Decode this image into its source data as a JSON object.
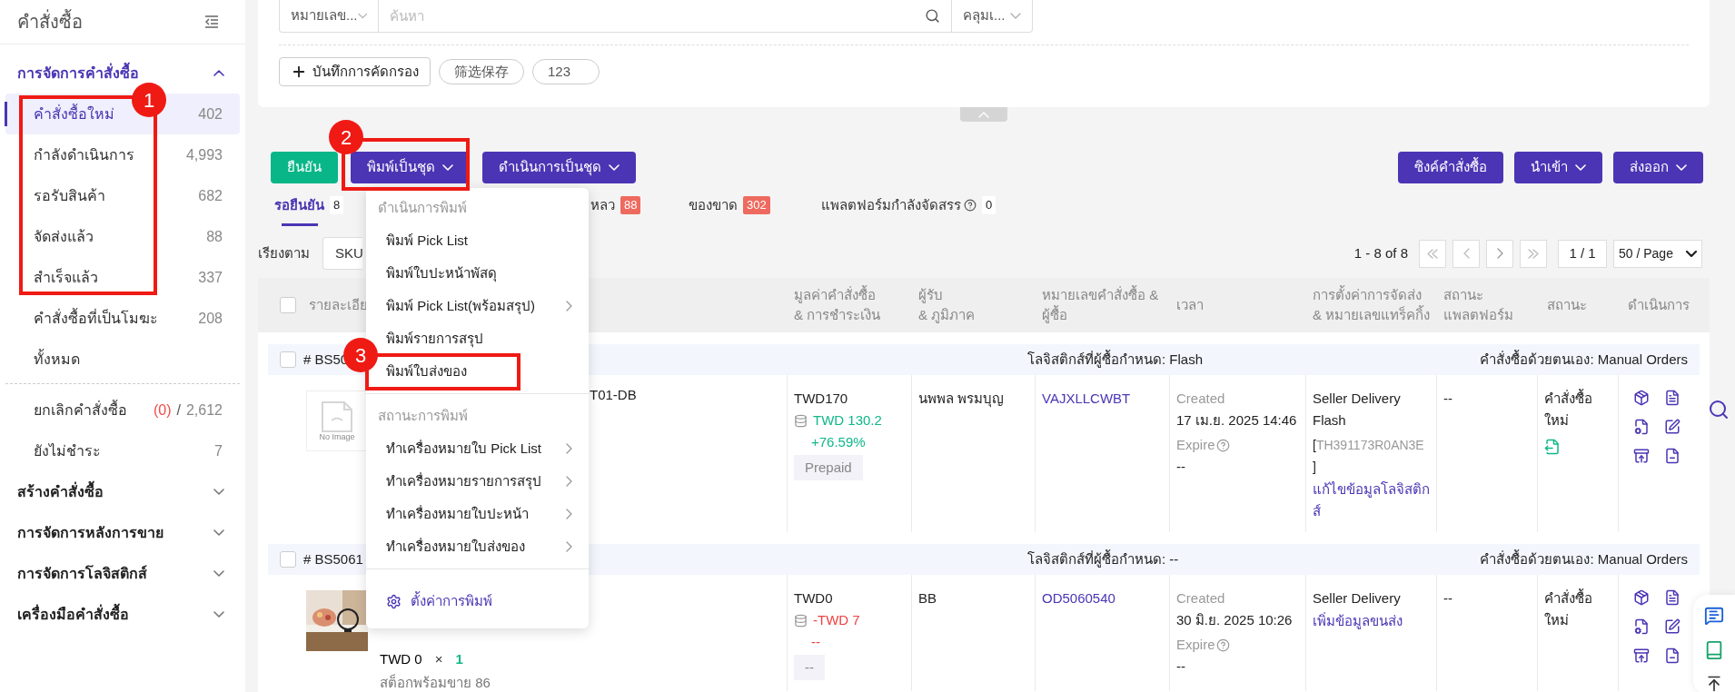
{
  "sidebar": {
    "title": "คำสั่งซื้อ",
    "sections": [
      {
        "label": "การจัดการคำสั่งซื้อ",
        "expanded": true,
        "callout": "1",
        "items": [
          {
            "label": "คำสั่งซื้อใหม่",
            "count": "402",
            "selected": true
          },
          {
            "label": "กำลังดำเนินการ",
            "count": "4,993",
            "selected": false
          },
          {
            "label": "รอรับสินค้า",
            "count": "682",
            "selected": false
          },
          {
            "label": "จัดส่งแล้ว",
            "count": "88",
            "selected": false
          },
          {
            "label": "สำเร็จแล้ว",
            "count": "337",
            "selected": false
          },
          {
            "label": "คำสั่งซื้อที่เป็นโมฆะ",
            "count": "208",
            "selected": false
          },
          {
            "label": "ทั้งหมด",
            "selected": false
          }
        ],
        "extra_items": [
          {
            "label": "ยกเลิกคำสั่งซื้อ",
            "alert_count": "(0)",
            "separator": "/",
            "count": "2,612",
            "selected": false
          },
          {
            "label": "ยังไม่ชำระ",
            "count": "7",
            "selected": false
          }
        ]
      },
      {
        "label": "สร้างคำสั่งซื้อ",
        "expanded": false
      },
      {
        "label": "การจัดการหลังการขาย",
        "expanded": false
      },
      {
        "label": "การจัดการโลจิสติกส์",
        "expanded": false
      },
      {
        "label": "เครื่องมือคำสั่งซื้อ",
        "expanded": false
      }
    ]
  },
  "filter": {
    "search_type": "หมายเลข...",
    "search": {
      "placeholder": "ค้นหา"
    },
    "scope": "คลุมเ...",
    "save_button": "บันทึกการคัดกรอง",
    "saved_filters": [
      "筛选保存",
      "123"
    ]
  },
  "toolbar": {
    "left": [
      {
        "label": "ยืนยัน",
        "kind": "confirm"
      },
      {
        "label": "พิมพ์เป็นชุด",
        "kind": "dropdown",
        "callout": "2"
      },
      {
        "label": "ดำเนินการเป็นชุด",
        "kind": "dropdown"
      }
    ],
    "right": [
      {
        "label": "ซิงค์คำสั่งซื้อ",
        "kind": "plain"
      },
      {
        "label": "นำเข้า",
        "kind": "dropdown"
      },
      {
        "label": "ส่งออก",
        "kind": "dropdown"
      }
    ]
  },
  "tabs": [
    {
      "label": "รอยืนยัน",
      "count": "8",
      "selected": true,
      "alert": false,
      "help": false
    },
    {
      "label": "หลว",
      "count": "88",
      "selected": false,
      "alert": true,
      "help": false
    },
    {
      "label": "ของขาด",
      "count": "302",
      "selected": false,
      "alert": true,
      "help": false
    },
    {
      "label": "แพลตฟอร์มกำลังจัดสรร",
      "count": "0",
      "selected": false,
      "alert": false,
      "help": true
    }
  ],
  "sort": {
    "label": "เรียงตาม",
    "value": "SKU"
  },
  "pagination": {
    "summary": "1 - 8 of 8",
    "page": "1 / 1",
    "page_size": "50 / Page"
  },
  "print_menu": {
    "sections": [
      {
        "title": "ดำเนินการพิมพ์",
        "items": [
          {
            "label": "พิมพ์ Pick List",
            "submenu": false
          },
          {
            "label": "พิมพ์ใบปะหน้าพัสดุ",
            "submenu": false
          },
          {
            "label": "พิมพ์ Pick List(พร้อมสรุป)",
            "submenu": true
          },
          {
            "label": "พิมพ์รายการสรุป",
            "submenu": false
          },
          {
            "label": "พิมพ์ใบส่งของ",
            "submenu": false,
            "callout": "3"
          }
        ]
      },
      {
        "title": "สถานะการพิมพ์",
        "items": [
          {
            "label": "ทำเครื่องหมายใบ Pick List",
            "submenu": true
          },
          {
            "label": "ทำเครื่องหมายรายการสรุป",
            "submenu": true
          },
          {
            "label": "ทำเครื่องหมายใบปะหน้า",
            "submenu": true
          },
          {
            "label": "ทำเครื่องหมายใบส่งของ",
            "submenu": true
          }
        ]
      }
    ],
    "settings": "ตั้งค่าการพิมพ์"
  },
  "table": {
    "select_all_checked": false,
    "columns": [
      {
        "lines": [
          "รายละเอีย"
        ]
      },
      {
        "lines": [
          "มูลค่าคำสั่งซื้อ",
          "& การชำระเงิน"
        ]
      },
      {
        "lines": [
          "ผู้รับ",
          "& ภูมิภาค"
        ]
      },
      {
        "lines": [
          "หมายเลขคำสั่งซื้อ &",
          "ผู้ซื้อ"
        ]
      },
      {
        "lines": [
          "เวลา"
        ]
      },
      {
        "lines": [
          "การตั้งค่าการจัดส่ง",
          "& หมายเลขแทร็คกิ้ง"
        ]
      },
      {
        "lines": [
          "สถานะ",
          "แพลตฟอร์ม"
        ]
      },
      {
        "lines": [
          "สถานะ"
        ]
      },
      {
        "lines": [
          "ดำเนินการ"
        ]
      }
    ],
    "orders": [
      {
        "checked": false,
        "number": "# BS50",
        "logistics": "โลจิสติกส์ที่ผู้ซื้อกำหนด: Flash",
        "source": "คำสั่งซื้อด้วยตนเอง: Manual Orders",
        "product": {
          "kind": "placeholder",
          "image_text": "No Image",
          "text": "T01-DB"
        },
        "value": "TWD170",
        "profit": {
          "text": "TWD 130.2",
          "rate": "+76.59%",
          "kind": "gain"
        },
        "payment": "Prepaid",
        "receiver": "นพพล พรมบุญ",
        "order_id": "VAJXLLCWBT",
        "created_label": "Created",
        "created": "17 เม.ย. 2025 14:46",
        "expire_label": "Expire",
        "expire": "--",
        "shipping": {
          "method": "Seller Delivery",
          "carrier": "Flash",
          "tracking": [
            "[",
            "TH391173R0AN3E",
            "]"
          ],
          "link": "แก้ไขข้อมูลโลจิสติกส์"
        },
        "platform_status": "--",
        "status": "คำสั่งซื้อใหม่",
        "status_icon": true
      },
      {
        "checked": false,
        "number": "# BS5061",
        "logistics": "โลจิสติกส์ที่ผู้ซื้อกำหนด: --",
        "source": "คำสั่งซื้อด้วยตนเอง: Manual Orders",
        "product": {
          "kind": "picture",
          "price": "TWD 0",
          "times": "×",
          "quantity": "1",
          "stock": "สต็อกพร้อมขาย 86"
        },
        "value": "TWD0",
        "profit": {
          "text": "-TWD 7",
          "rate": "--",
          "kind": "loss"
        },
        "payment": "--",
        "receiver": "BB",
        "order_id": "OD5060540",
        "created_label": "Created",
        "created": "30 มิ.ย. 2025 10:26",
        "expire_label": "Expire",
        "expire": "--",
        "shipping": {
          "method": "Seller Delivery",
          "link": "เพิ่มข้อมูลขนส่ง"
        },
        "platform_status": "--",
        "status": "คำสั่งซื้อใหม่",
        "status_icon": false
      }
    ]
  }
}
